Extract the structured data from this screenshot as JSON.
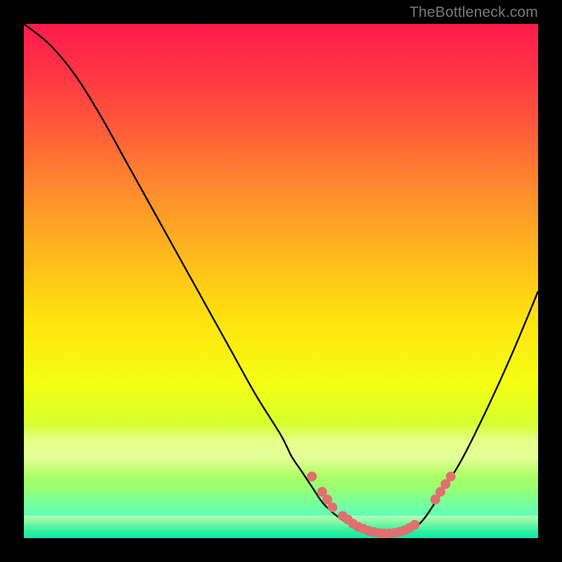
{
  "watermark": "TheBottleneck.com",
  "colors": {
    "frame": "#000000",
    "curve": "#000000",
    "markerFill": "#e0706e",
    "markerStroke": "#d05a58"
  },
  "chart_data": {
    "type": "line",
    "title": "",
    "xlabel": "",
    "ylabel": "",
    "xlim": [
      0,
      100
    ],
    "ylim": [
      0,
      100
    ],
    "grid": false,
    "series": [
      {
        "name": "bottleneck-curve",
        "x": [
          0,
          5,
          10,
          15,
          20,
          25,
          30,
          35,
          40,
          45,
          50,
          52,
          54,
          56,
          58,
          60,
          62,
          64,
          66,
          68,
          70,
          72,
          74,
          76,
          78,
          80,
          85,
          90,
          95,
          100
        ],
        "y": [
          100,
          96,
          90,
          82,
          73,
          64,
          55,
          46,
          37,
          28,
          20,
          16,
          13,
          10,
          7,
          5,
          3.5,
          2.3,
          1.5,
          1,
          0.7,
          0.7,
          1,
          2,
          4,
          7,
          15,
          25,
          36,
          48
        ]
      }
    ],
    "markers": [
      {
        "x": 56,
        "y": 12
      },
      {
        "x": 58,
        "y": 9
      },
      {
        "x": 59,
        "y": 7.5
      },
      {
        "x": 60,
        "y": 6
      },
      {
        "x": 62,
        "y": 4.3
      },
      {
        "x": 63,
        "y": 3.6
      },
      {
        "x": 64,
        "y": 2.8
      },
      {
        "x": 65,
        "y": 2.2
      },
      {
        "x": 66,
        "y": 1.8
      },
      {
        "x": 67,
        "y": 1.4
      },
      {
        "x": 68,
        "y": 1.2
      },
      {
        "x": 69,
        "y": 1.0
      },
      {
        "x": 70,
        "y": 0.9
      },
      {
        "x": 71,
        "y": 0.9
      },
      {
        "x": 72,
        "y": 1.0
      },
      {
        "x": 73,
        "y": 1.2
      },
      {
        "x": 74,
        "y": 1.5
      },
      {
        "x": 75,
        "y": 2.0
      },
      {
        "x": 76,
        "y": 2.6
      },
      {
        "x": 80,
        "y": 7.5
      },
      {
        "x": 81,
        "y": 9
      },
      {
        "x": 82,
        "y": 10.5
      },
      {
        "x": 83,
        "y": 12
      }
    ]
  }
}
